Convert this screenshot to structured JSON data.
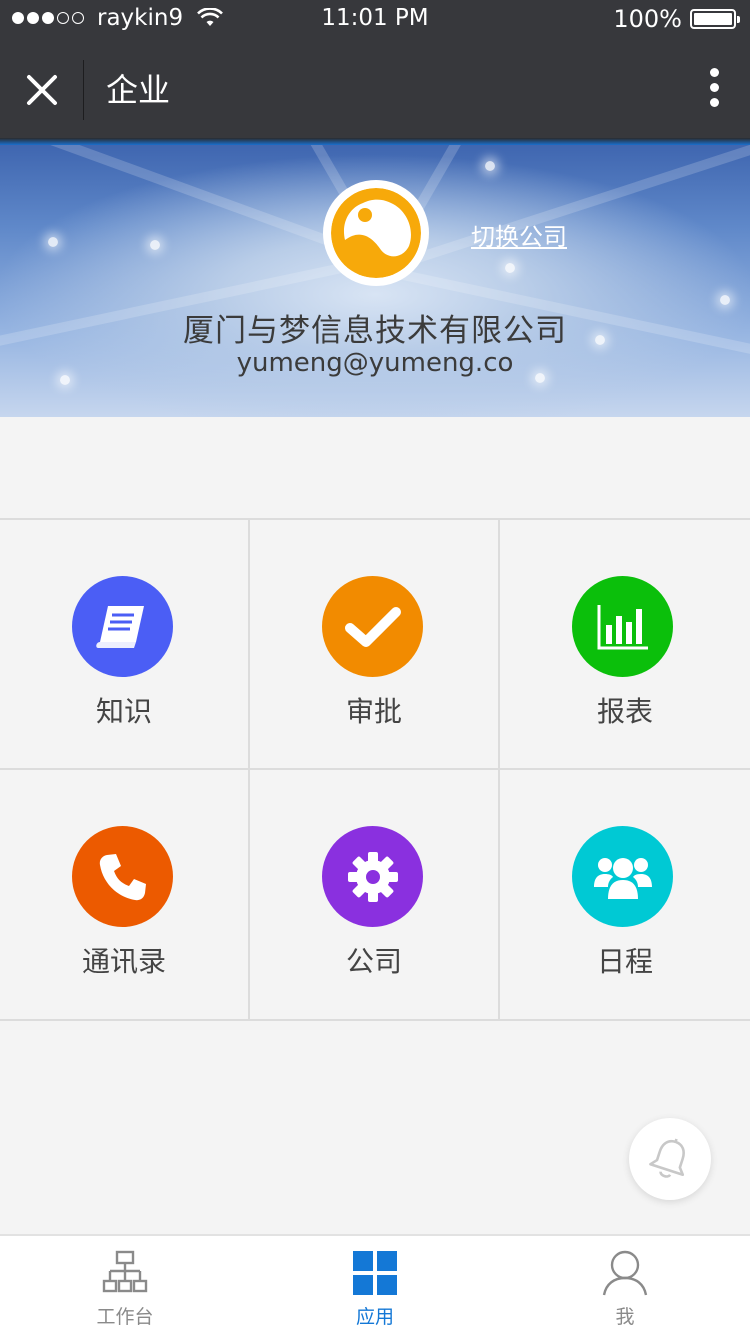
{
  "status_bar": {
    "carrier": "raykin9",
    "time": "11:01 PM",
    "battery": "100%",
    "signal_full": 3,
    "signal_empty": 2
  },
  "nav": {
    "title": "企业",
    "close_icon": "close-icon",
    "more_icon": "more-vertical-icon"
  },
  "banner": {
    "switch_label": "切换公司",
    "company_name": "厦门与梦信息技术有限公司",
    "email": "yumeng@yumeng.co"
  },
  "apps": [
    {
      "label": "知识",
      "icon": "book-icon",
      "color": "#4b5ef5"
    },
    {
      "label": "审批",
      "icon": "checkmark-icon",
      "color": "#f28b00"
    },
    {
      "label": "报表",
      "icon": "bar-chart-icon",
      "color": "#0bbf0b"
    },
    {
      "label": "通讯录",
      "icon": "phone-icon",
      "color": "#ec5a00"
    },
    {
      "label": "公司",
      "icon": "gear-icon",
      "color": "#8a30df"
    },
    {
      "label": "日程",
      "icon": "people-icon",
      "color": "#00c9d4"
    }
  ],
  "floating": {
    "icon": "bell-icon"
  },
  "tabs": [
    {
      "label": "工作台",
      "icon": "org-chart-icon",
      "active": false
    },
    {
      "label": "应用",
      "icon": "grid-icon",
      "active": true
    },
    {
      "label": "我",
      "icon": "user-icon",
      "active": false
    }
  ],
  "colors": {
    "header_bg": "#37383c",
    "accent": "#1478d6",
    "page_bg": "#f4f4f4"
  }
}
